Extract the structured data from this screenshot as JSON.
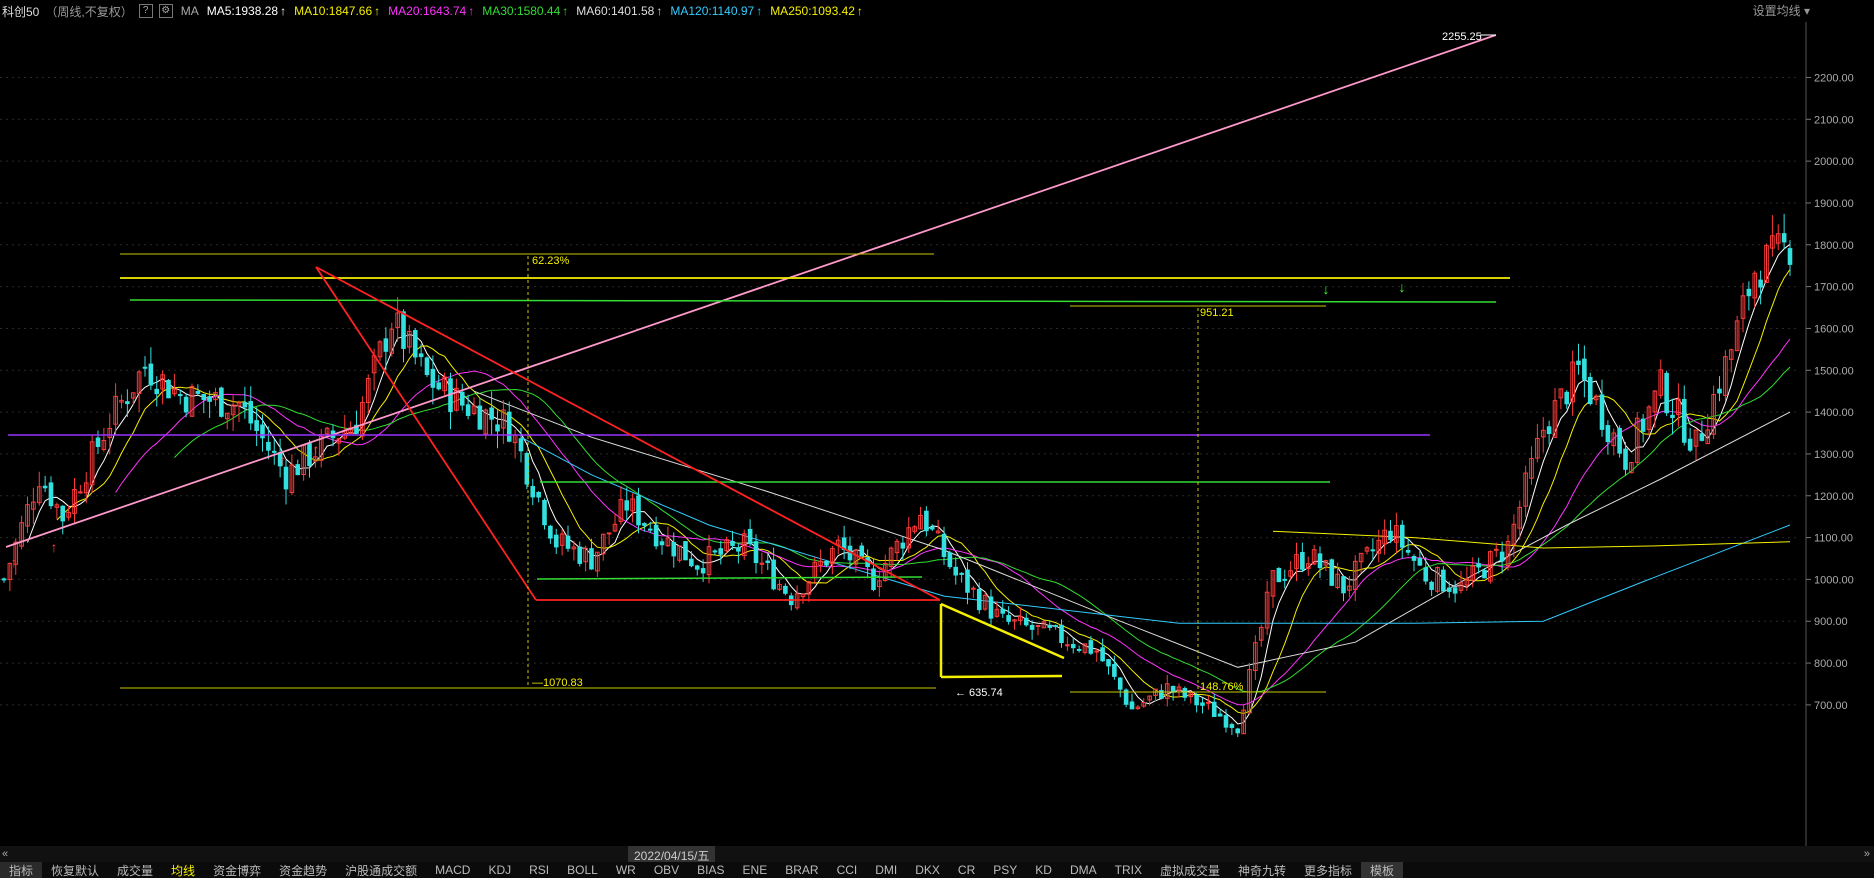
{
  "header": {
    "symbol": "科创50",
    "subtitle": "（周线,不复权）",
    "help": "?",
    "settings_icon": "gear-icon",
    "ma_label": "MA",
    "settings_label": "设置均线"
  },
  "ma_values": [
    {
      "label": "MA5:1938.28",
      "color": "#ffffff"
    },
    {
      "label": "MA10:1847.66",
      "color": "#f5f000"
    },
    {
      "label": "MA20:1643.74",
      "color": "#ff33ff"
    },
    {
      "label": "MA30:1580.44",
      "color": "#33dd33"
    },
    {
      "label": "MA60:1401.58",
      "color": "#dddddd"
    },
    {
      "label": "MA120:1140.97",
      "color": "#33ccff"
    },
    {
      "label": "MA250:1093.42",
      "color": "#f5f000"
    }
  ],
  "annotations": {
    "high_label": "2255.25",
    "low_label": "635.74",
    "pct1": "62.23%",
    "pct2": "951.21",
    "pct3": "1070.83",
    "pct4": "148.76%",
    "date_label": "2022/04/15/五"
  },
  "chart_data": {
    "type": "candlestick",
    "ylim": [
      640,
      2280
    ],
    "ytick_values": [
      700,
      800,
      900,
      1000,
      1100,
      1200,
      1300,
      1400,
      1500,
      1600,
      1700,
      1800,
      1900,
      2000,
      2100,
      2200
    ],
    "ytick_labels": [
      "700.00",
      "800.00",
      "900.00",
      "1000.00",
      "1100.00",
      "1200.00",
      "1300.00",
      "1400.00",
      "1500.00",
      "1600.00",
      "1700.00",
      "1800.00",
      "1900.00",
      "2000.00",
      "2100.00",
      "2200.00"
    ],
    "price_path": [
      [
        0,
        1000
      ],
      [
        6,
        1250
      ],
      [
        10,
        1150
      ],
      [
        18,
        1380
      ],
      [
        24,
        1510
      ],
      [
        30,
        1440
      ],
      [
        40,
        1420
      ],
      [
        48,
        1250
      ],
      [
        54,
        1320
      ],
      [
        60,
        1380
      ],
      [
        66,
        1620
      ],
      [
        72,
        1480
      ],
      [
        78,
        1420
      ],
      [
        86,
        1370
      ],
      [
        94,
        1090
      ],
      [
        100,
        1050
      ],
      [
        106,
        1180
      ],
      [
        112,
        1100
      ],
      [
        118,
        1040
      ],
      [
        126,
        1080
      ],
      [
        134,
        960
      ],
      [
        142,
        1080
      ],
      [
        148,
        1000
      ],
      [
        156,
        1160
      ],
      [
        162,
        1010
      ],
      [
        170,
        900
      ],
      [
        178,
        870
      ],
      [
        186,
        830
      ],
      [
        192,
        690
      ],
      [
        198,
        740
      ],
      [
        204,
        700
      ],
      [
        210,
        650
      ],
      [
        216,
        1000
      ],
      [
        222,
        1060
      ],
      [
        228,
        980
      ],
      [
        236,
        1120
      ],
      [
        242,
        1010
      ],
      [
        248,
        980
      ],
      [
        256,
        1080
      ],
      [
        262,
        1360
      ],
      [
        268,
        1500
      ],
      [
        276,
        1290
      ],
      [
        282,
        1460
      ],
      [
        288,
        1320
      ],
      [
        294,
        1550
      ],
      [
        298,
        1740
      ],
      [
        304,
        1800
      ]
    ],
    "count": 305,
    "ma_series": {
      "MA120": [
        [
          88,
          1340
        ],
        [
          100,
          1250
        ],
        [
          120,
          1130
        ],
        [
          160,
          960
        ],
        [
          200,
          895
        ],
        [
          240,
          895
        ],
        [
          262,
          900
        ],
        [
          280,
          1000
        ],
        [
          304,
          1130
        ]
      ],
      "MA250": [
        [
          216,
          1115
        ],
        [
          240,
          1100
        ],
        [
          262,
          1075
        ],
        [
          280,
          1080
        ],
        [
          304,
          1090
        ]
      ],
      "MA60": [
        [
          80,
          1450
        ],
        [
          100,
          1340
        ],
        [
          130,
          1210
        ],
        [
          160,
          1070
        ],
        [
          190,
          900
        ],
        [
          210,
          790
        ],
        [
          230,
          850
        ],
        [
          250,
          1010
        ],
        [
          266,
          1130
        ],
        [
          282,
          1240
        ],
        [
          304,
          1400
        ]
      ]
    }
  },
  "tabs": [
    "指标",
    "恢复默认",
    "成交量",
    "均线",
    "资金博弈",
    "资金趋势",
    "沪股通成交额",
    "MACD",
    "KDJ",
    "RSI",
    "BOLL",
    "WR",
    "OBV",
    "BIAS",
    "ENE",
    "BRAR",
    "CCI",
    "DMI",
    "DKX",
    "CR",
    "PSY",
    "KD",
    "DMA",
    "TRIX",
    "虚拟成交量",
    "神奇九转",
    "更多指标",
    "模板"
  ],
  "active_tab": "均线"
}
